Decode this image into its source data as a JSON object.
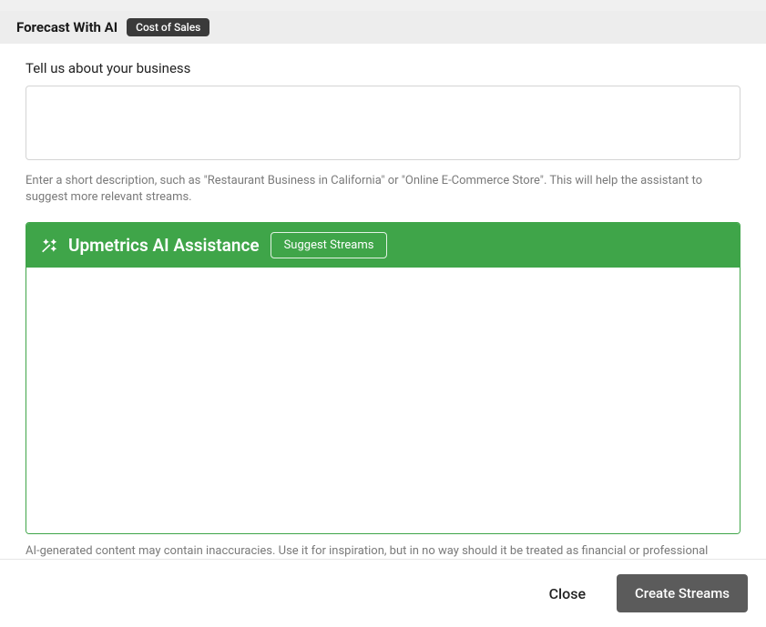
{
  "header": {
    "title": "Forecast With AI",
    "badge": "Cost of Sales"
  },
  "business_section": {
    "label": "Tell us about your business",
    "input_value": "",
    "helper": "Enter a short description, such as \"Restaurant Business in California\" or \"Online E-Commerce Store\". This will help the assistant to suggest more relevant streams."
  },
  "ai_panel": {
    "title": "Upmetrics AI Assistance",
    "suggest_button": "Suggest Streams",
    "disclaimer": "AI-generated content may contain inaccuracies. Use it for inspiration, but in no way should it be treated as financial or professional advice."
  },
  "footer": {
    "close": "Close",
    "create": "Create Streams"
  }
}
